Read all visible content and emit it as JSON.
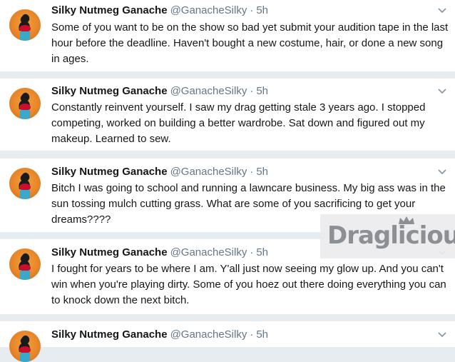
{
  "tweets": [
    {
      "name": "Silky Nutmeg Ganache",
      "handle": "@GanacheSilky",
      "separator": "·",
      "time": "5h",
      "text": "Some of you want to be on the show so bad yet submit your audition tape in the last hour before the deadline. Haven't bought a new costume, hair, or done a new song in ages."
    },
    {
      "name": "Silky Nutmeg Ganache",
      "handle": "@GanacheSilky",
      "separator": "·",
      "time": "5h",
      "text": "Constantly reinvent yourself. I saw my drag getting stale 3 years ago. I stopped competing, worked on building a better wardrobe. Sat down and figured out my makeup. Learned to sew."
    },
    {
      "name": "Silky Nutmeg Ganache",
      "handle": "@GanacheSilky",
      "separator": "·",
      "time": "5h",
      "text": "Bitch I was going to school and running a lawncare business. My big ass was in the sun tossing mulch cutting grass. What are some of you sacrificing to get your dreams????"
    },
    {
      "name": "Silky Nutmeg Ganache",
      "handle": "@GanacheSilky",
      "separator": "·",
      "time": "5h",
      "text": "I fought for years to be where I am. Y'all just now seeing my glow up. And you can't win when you're playing dirty. Some of you hoez out there doing everything you can to knock down the next bitch."
    },
    {
      "name": "Silky Nutmeg Ganache",
      "handle": "@GanacheSilky",
      "separator": "·",
      "time": "5h",
      "text": ""
    }
  ],
  "watermark": {
    "text": "Draglicious"
  },
  "icons": {
    "menu": "chevron-down-icon",
    "avatar": "profile-avatar"
  },
  "colors": {
    "background": "#e6ecf0",
    "name": "#14171a",
    "meta": "#657786",
    "avatar": "#e8862a"
  }
}
